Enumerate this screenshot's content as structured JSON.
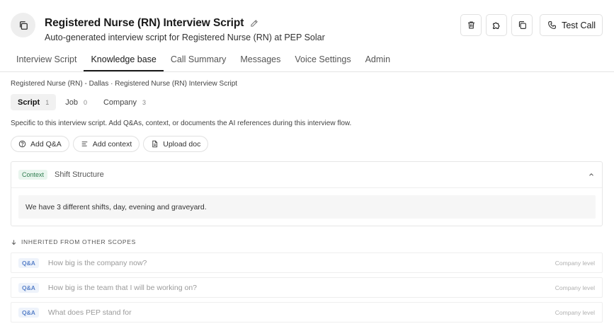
{
  "header": {
    "title": "Registered Nurse (RN) Interview Script",
    "subtitle": "Auto-generated interview script for Registered Nurse (RN) at PEP Solar",
    "test_call_label": "Test Call"
  },
  "tabs": [
    {
      "label": "Interview Script",
      "active": false
    },
    {
      "label": "Knowledge base",
      "active": true
    },
    {
      "label": "Call Summary",
      "active": false
    },
    {
      "label": "Messages",
      "active": false
    },
    {
      "label": "Voice Settings",
      "active": false
    },
    {
      "label": "Admin",
      "active": false
    }
  ],
  "breadcrumb": "Registered Nurse (RN) - Dallas · Registered Nurse (RN) Interview Script",
  "scope_tabs": [
    {
      "label": "Script",
      "count": "1",
      "active": true
    },
    {
      "label": "Job",
      "count": "0",
      "active": false
    },
    {
      "label": "Company",
      "count": "3",
      "active": false
    }
  ],
  "description": "Specific to this interview script. Add Q&As, context, or documents the AI references during this interview flow.",
  "add_buttons": {
    "add_qa": "Add Q&A",
    "add_context": "Add context",
    "upload_doc": "Upload doc"
  },
  "context_item": {
    "badge": "Context",
    "title": "Shift Structure",
    "body": "We have 3 different shifts, day, evening and graveyard."
  },
  "inherited": {
    "header": "INHERITED FROM OTHER SCOPES",
    "items": [
      {
        "badge": "Q&A",
        "question": "How big is the company now?",
        "level": "Company level"
      },
      {
        "badge": "Q&A",
        "question": "How big is the team that I will be working on?",
        "level": "Company level"
      },
      {
        "badge": "Q&A",
        "question": "What does PEP stand for",
        "level": "Company level"
      }
    ]
  }
}
